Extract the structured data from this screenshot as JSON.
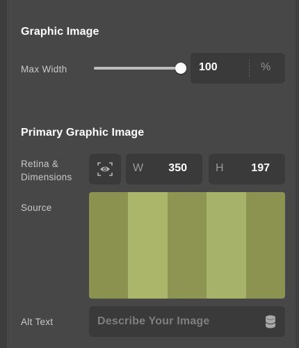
{
  "graphic_image": {
    "title": "Graphic Image",
    "max_width": {
      "label": "Max Width",
      "value": "100",
      "unit": "%",
      "slider_fraction": 1.0
    }
  },
  "primary_graphic_image": {
    "title": "Primary Graphic Image",
    "retina": {
      "label_line1": "Retina &",
      "label_line2": "Dimensions",
      "toggle_icon": "eye-icon",
      "width_letter": "W",
      "width_value": "350",
      "height_letter": "H",
      "height_value": "197"
    },
    "source": {
      "label": "Source",
      "stripes": [
        "#8b914f",
        "#abb66a",
        "#8e9552",
        "#a6b169",
        "#8c9250"
      ]
    },
    "alt_text": {
      "label": "Alt Text",
      "placeholder": "Describe Your Image",
      "icon": "database-icon"
    }
  },
  "colors": {
    "panel_bg": "#474747",
    "input_bg": "#3a3a3a",
    "text": "#ffffff",
    "muted": "#c9c9c9"
  }
}
